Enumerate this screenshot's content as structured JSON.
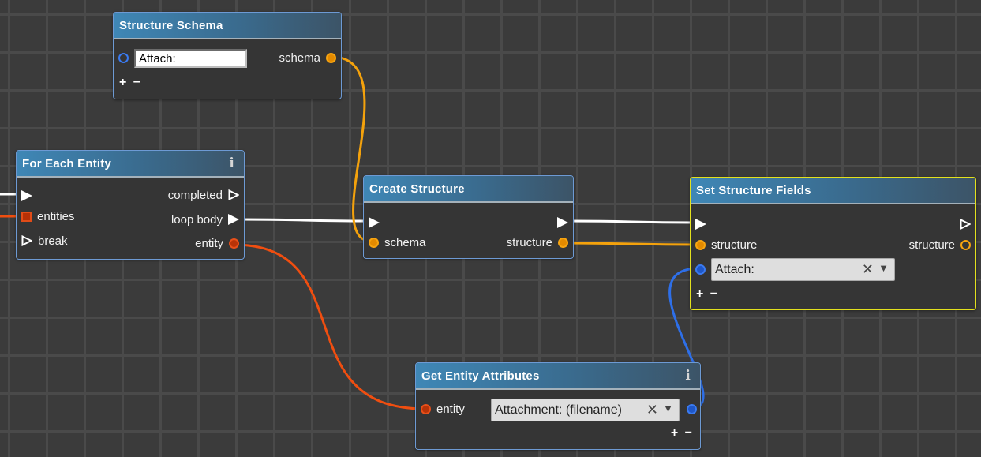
{
  "colors": {
    "exec_wire": "#ffffff",
    "schema_wire": "#f4a20c",
    "entity_wire": "#f04e10",
    "attribute_wire": "#2e6fe8",
    "node_border": "#6d9ad4",
    "selected_border": "#e3e11e"
  },
  "nodes": {
    "structure_schema": {
      "title": "Structure Schema",
      "input_value": "Attach:",
      "output_label": "schema",
      "add_label": "+",
      "remove_label": "−"
    },
    "for_each_entity": {
      "title": "For Each Entity",
      "info_icon": "i",
      "inputs": [
        "",
        "entities",
        "break"
      ],
      "outputs": [
        "completed",
        "loop body",
        "entity"
      ]
    },
    "create_structure": {
      "title": "Create Structure",
      "input_label": "schema",
      "output_label": "structure"
    },
    "set_structure_fields": {
      "title": "Set Structure Fields",
      "input_label": "structure",
      "output_label": "structure",
      "field_value": "Attach:",
      "clear_icon": "✕",
      "dropdown_icon": "▼",
      "add_label": "+",
      "remove_label": "−"
    },
    "get_entity_attributes": {
      "title": "Get Entity Attributes",
      "info_icon": "i",
      "input_label": "entity",
      "attribute_value": "Attachment: (filename)",
      "clear_icon": "✕",
      "dropdown_icon": "▼",
      "add_label": "+",
      "remove_label": "−"
    }
  }
}
